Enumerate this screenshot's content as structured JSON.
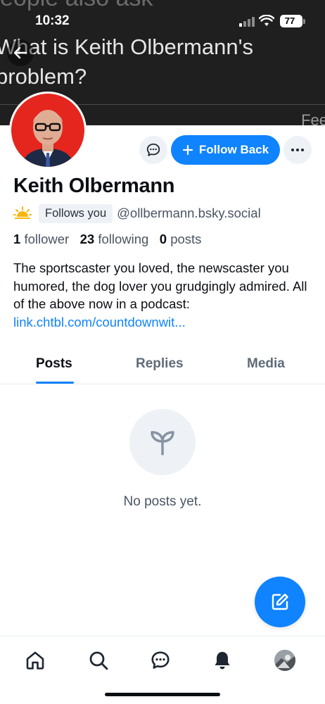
{
  "status": {
    "time": "10:32",
    "battery": "77"
  },
  "banner": {
    "top_text": "eople also ask",
    "title": "What is Keith Olbermann's problem?",
    "corner_text": "Fee"
  },
  "profile": {
    "display_name": "Keith Olbermann",
    "follows_badge": "Follows you",
    "handle": "@ollbermann.bsky.social",
    "followers_count": "1",
    "followers_label": "follower",
    "following_count": "23",
    "following_label": "following",
    "posts_count": "0",
    "posts_label": "posts",
    "bio": "The sportscaster you loved, the newscaster you humored, the dog lover you grudgingly admired. All of the above now in a podcast:",
    "bio_link": "link.chtbl.com/countdownwit..."
  },
  "actions": {
    "follow_label": "Follow Back"
  },
  "tabs": [
    {
      "label": "Posts",
      "active": true
    },
    {
      "label": "Replies",
      "active": false
    },
    {
      "label": "Media",
      "active": false
    }
  ],
  "empty_state": {
    "text": "No posts yet.",
    "icon": "seedling-icon"
  },
  "colors": {
    "accent": "#1083fe",
    "muted_bg": "#eef2f6",
    "banner_bg": "#1f1f1f",
    "avatar_bg": "#e5261f"
  },
  "nav": [
    "home-icon",
    "search-icon",
    "chat-icon",
    "bell-icon",
    "profile-avatar"
  ]
}
